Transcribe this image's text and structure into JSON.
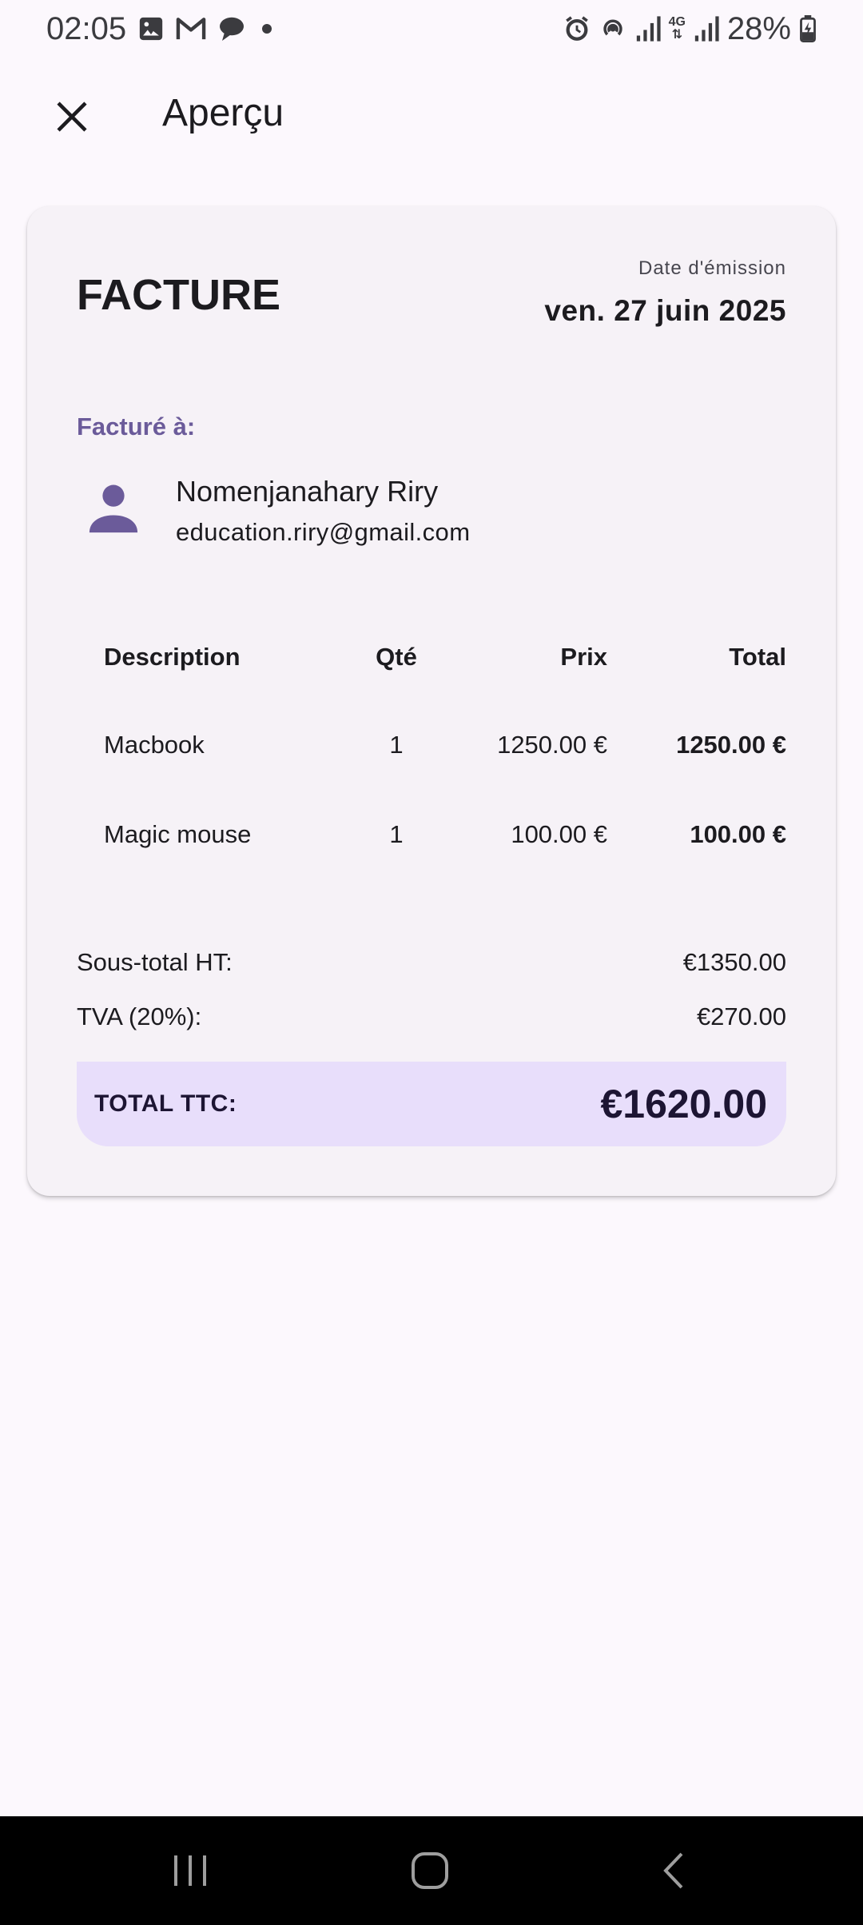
{
  "status_bar": {
    "time": "02:05",
    "battery": "28%",
    "network": "4G"
  },
  "app_bar": {
    "title": "Aperçu"
  },
  "invoice": {
    "title": "FACTURE",
    "date_label": "Date d'émission",
    "date_value": "ven. 27 juin 2025",
    "billed_to_label": "Facturé à:",
    "client": {
      "name": "Nomenjanahary Riry",
      "email": "education.riry@gmail.com"
    },
    "table": {
      "headers": {
        "description": "Description",
        "qty": "Qté",
        "price": "Prix",
        "total": "Total"
      },
      "rows": [
        {
          "description": "Macbook",
          "qty": "1",
          "price": "1250.00 €",
          "total": "1250.00 €"
        },
        {
          "description": "Magic mouse",
          "qty": "1",
          "price": "100.00 €",
          "total": "100.00 €"
        }
      ]
    },
    "subtotal_label": "Sous-total HT:",
    "subtotal_value": "€1350.00",
    "vat_label": "TVA (20%):",
    "vat_value": "€270.00",
    "total_label": "TOTAL TTC:",
    "total_value": "€1620.00"
  },
  "colors": {
    "accent": "#6b5b9a",
    "total_bg": "#e8defb",
    "card_bg": "#f6f2f7",
    "page_bg": "#fcf8fd"
  }
}
